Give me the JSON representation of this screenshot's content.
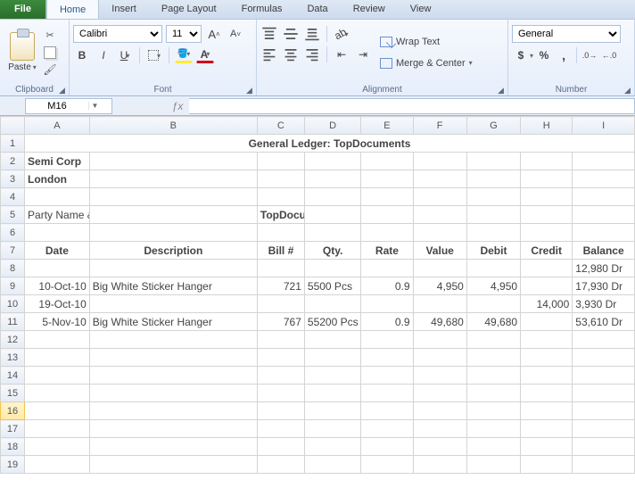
{
  "tabs": {
    "file": "File",
    "list": [
      "Home",
      "Insert",
      "Page Layout",
      "Formulas",
      "Data",
      "Review",
      "View"
    ],
    "active": "Home"
  },
  "clipboard": {
    "paste": "Paste",
    "label": "Clipboard"
  },
  "font": {
    "family": "Calibri",
    "size": "11",
    "label": "Font",
    "bold": "B",
    "italic": "I",
    "underline": "U",
    "grow": "A",
    "shrink": "A",
    "fontcolor": "A",
    "fill": ""
  },
  "alignment": {
    "label": "Alignment",
    "wrap": "Wrap Text",
    "merge": "Merge & Center"
  },
  "number": {
    "format": "General",
    "label": "Number"
  },
  "namebox": "M16",
  "formula": "",
  "columns": [
    "A",
    "B",
    "C",
    "D",
    "E",
    "F",
    "G",
    "H",
    "I"
  ],
  "rows": [
    "1",
    "2",
    "3",
    "4",
    "5",
    "6",
    "7",
    "8",
    "9",
    "10",
    "11",
    "12",
    "13",
    "14",
    "15",
    "16",
    "17",
    "18",
    "19"
  ],
  "selected_row": "16",
  "sheet": {
    "title": "General Ledger: TopDocuments",
    "company": "Semi Corp",
    "city": "London",
    "party_label": "Party Name & Address:",
    "party_value": "TopDocuments, Leeds, UK",
    "headers": {
      "date": "Date",
      "desc": "Description",
      "bill": "Bill #",
      "qty": "Qty.",
      "rate": "Rate",
      "value": "Value",
      "debit": "Debit",
      "credit": "Credit",
      "balance": "Balance"
    },
    "rows": [
      {
        "date": "",
        "desc": "",
        "bill": "",
        "qty": "",
        "rate": "",
        "value": "",
        "debit": "",
        "credit": "",
        "balance": "12,980  Dr"
      },
      {
        "date": "10-Oct-10",
        "desc": "Big White Sticker Hanger",
        "bill": "721",
        "qty": "5500 Pcs",
        "rate": "0.9",
        "value": "4,950",
        "debit": "4,950",
        "credit": "",
        "balance": "17,930  Dr"
      },
      {
        "date": "19-Oct-10",
        "desc": "",
        "bill": "",
        "qty": "",
        "rate": "",
        "value": "",
        "debit": "",
        "credit": "14,000",
        "balance": "3,930  Dr"
      },
      {
        "date": "5-Nov-10",
        "desc": "Big White Sticker Hanger",
        "bill": "767",
        "qty": "55200 Pcs",
        "rate": "0.9",
        "value": "49,680",
        "debit": "49,680",
        "credit": "",
        "balance": "53,610  Dr"
      }
    ]
  }
}
